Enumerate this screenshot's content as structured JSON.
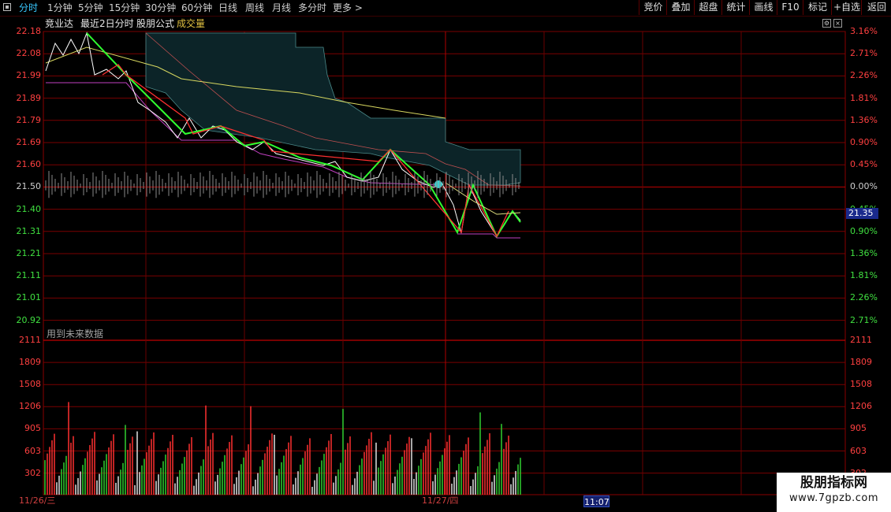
{
  "toolbar": {
    "periods": [
      "分时",
      "1分钟",
      "5分钟",
      "15分钟",
      "30分钟",
      "60分钟",
      "日线",
      "周线",
      "月线",
      "多分时",
      "更多 >"
    ],
    "active": "分时",
    "buttons": [
      "竞价",
      "叠加",
      "超盘",
      "统计",
      "画线",
      "F10",
      "标记",
      "+自选",
      "返回"
    ]
  },
  "header": {
    "stock": "竞业达",
    "mode": "最近2日分时",
    "formula": "股朋公式",
    "indicator": "成交量"
  },
  "price_axis": {
    "left": [
      "22.18",
      "22.08",
      "21.99",
      "21.89",
      "21.79",
      "21.69",
      "21.60",
      "21.50",
      "21.40",
      "21.31",
      "21.21",
      "21.11",
      "21.01",
      "20.92"
    ],
    "right": [
      "3.16%",
      "2.71%",
      "2.26%",
      "1.81%",
      "1.36%",
      "0.90%",
      "0.45%",
      "0.00%",
      "0.45%",
      "0.90%",
      "1.36%",
      "1.81%",
      "2.26%",
      "2.71%"
    ],
    "prev_close": "21.50",
    "current_price": "21.35"
  },
  "volume_axis": {
    "labels": [
      "2111",
      "1809",
      "1508",
      "1206",
      "905",
      "603",
      "302"
    ],
    "note": "用到未来数据"
  },
  "dates": [
    "11/26/三",
    "11/27/四"
  ],
  "cursor_time": "11:07",
  "watermark": {
    "line1": "股朋指标网",
    "line2": "www.7gpzb.com"
  },
  "colors": {
    "up": "#ff3030",
    "down": "#3cff3c",
    "grid": "#7a0000",
    "axis_up": "#ff4040",
    "axis_down": "#40e040"
  }
}
